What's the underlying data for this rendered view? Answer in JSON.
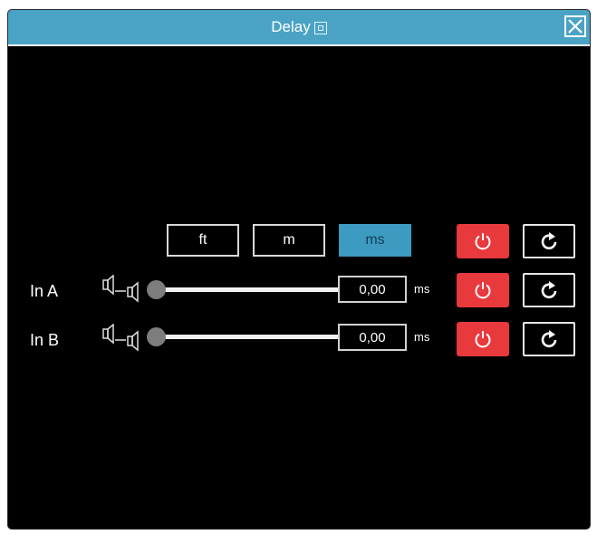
{
  "window": {
    "title": "Delay"
  },
  "units": {
    "ft_label": "ft",
    "m_label": "m",
    "ms_label": "ms",
    "selected": "ms"
  },
  "channels": [
    {
      "label": "In A",
      "delay_value": "0,00",
      "unit": "ms",
      "slider_level": 0
    },
    {
      "label": "In B",
      "delay_value": "0,00",
      "unit": "ms",
      "slider_level": 0
    }
  ],
  "icons": {
    "close": "close-icon",
    "title": "window-icon",
    "power": "power-icon",
    "reset": "reset-icon",
    "speaker": "speaker-pair-icon"
  },
  "colors": {
    "titlebar": "#4aa3c4",
    "active_unit": "#3d9ac0",
    "power_button": "#e8393d",
    "background": "#000000"
  }
}
